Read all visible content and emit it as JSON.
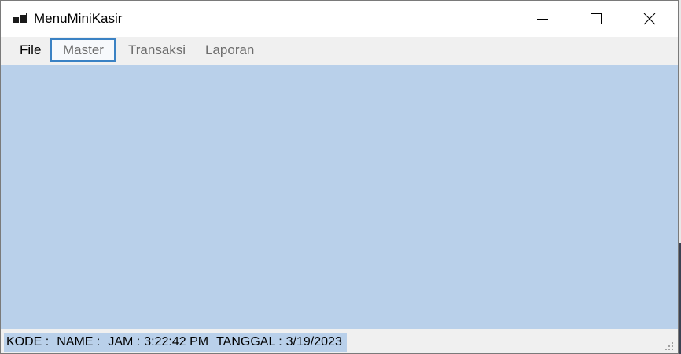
{
  "window": {
    "title": "MenuMiniKasir",
    "icon": "app-window-icon"
  },
  "caption_buttons": {
    "minimize": "minimize-icon",
    "maximize": "maximize-icon",
    "close": "close-icon"
  },
  "menubar": {
    "items": [
      {
        "label": "File",
        "selected": false
      },
      {
        "label": "Master",
        "selected": true
      },
      {
        "label": "Transaksi",
        "selected": false
      },
      {
        "label": "Laporan",
        "selected": false
      }
    ]
  },
  "statusbar": {
    "kode_label": "KODE :",
    "name_label": "NAME :",
    "jam_label": "JAM :",
    "jam_value": "3:22:42 PM",
    "tanggal_label": "TANGGAL :",
    "tanggal_value": "3/19/2023"
  },
  "colors": {
    "client_background": "#b9d0ea",
    "menu_selected_border": "#3b82c4",
    "menubar_background": "#f0f0f0"
  }
}
